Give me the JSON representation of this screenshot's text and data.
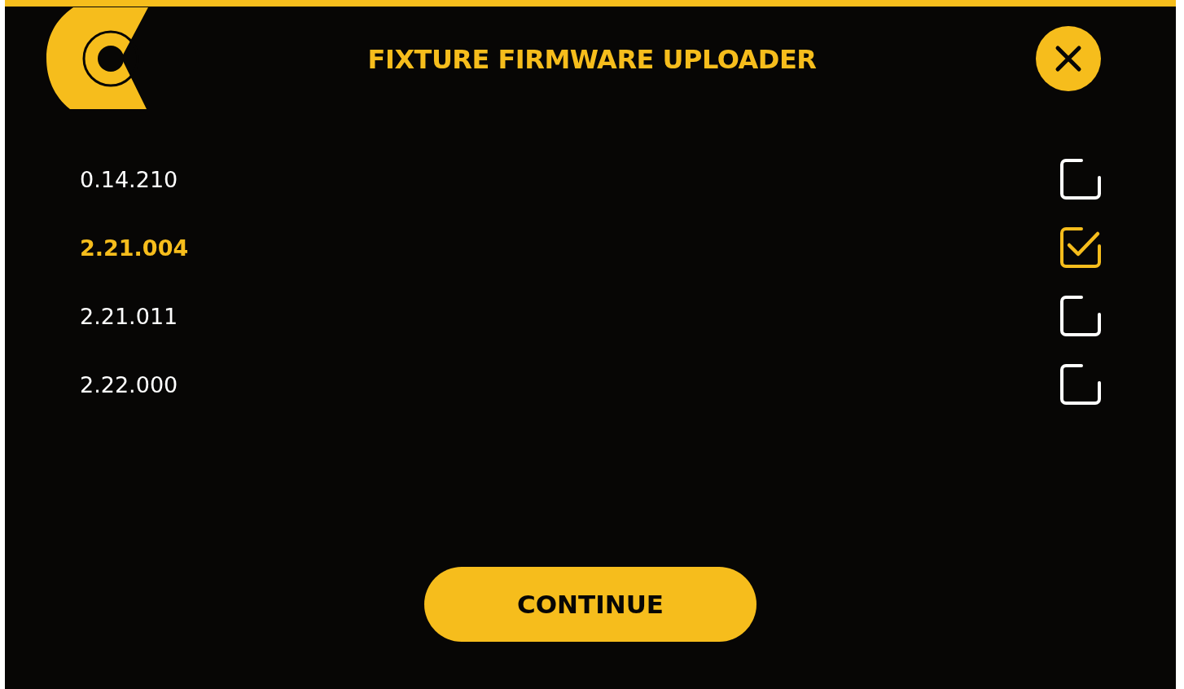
{
  "window": {
    "title": "FIXTURE FIRMWARE UPLOADER"
  },
  "versions": [
    {
      "label": "0.14.210",
      "selected": false
    },
    {
      "label": "2.21.004",
      "selected": true
    },
    {
      "label": "2.21.011",
      "selected": false
    },
    {
      "label": "2.22.000",
      "selected": false
    }
  ],
  "buttons": [
    "CONTINUE"
  ]
}
